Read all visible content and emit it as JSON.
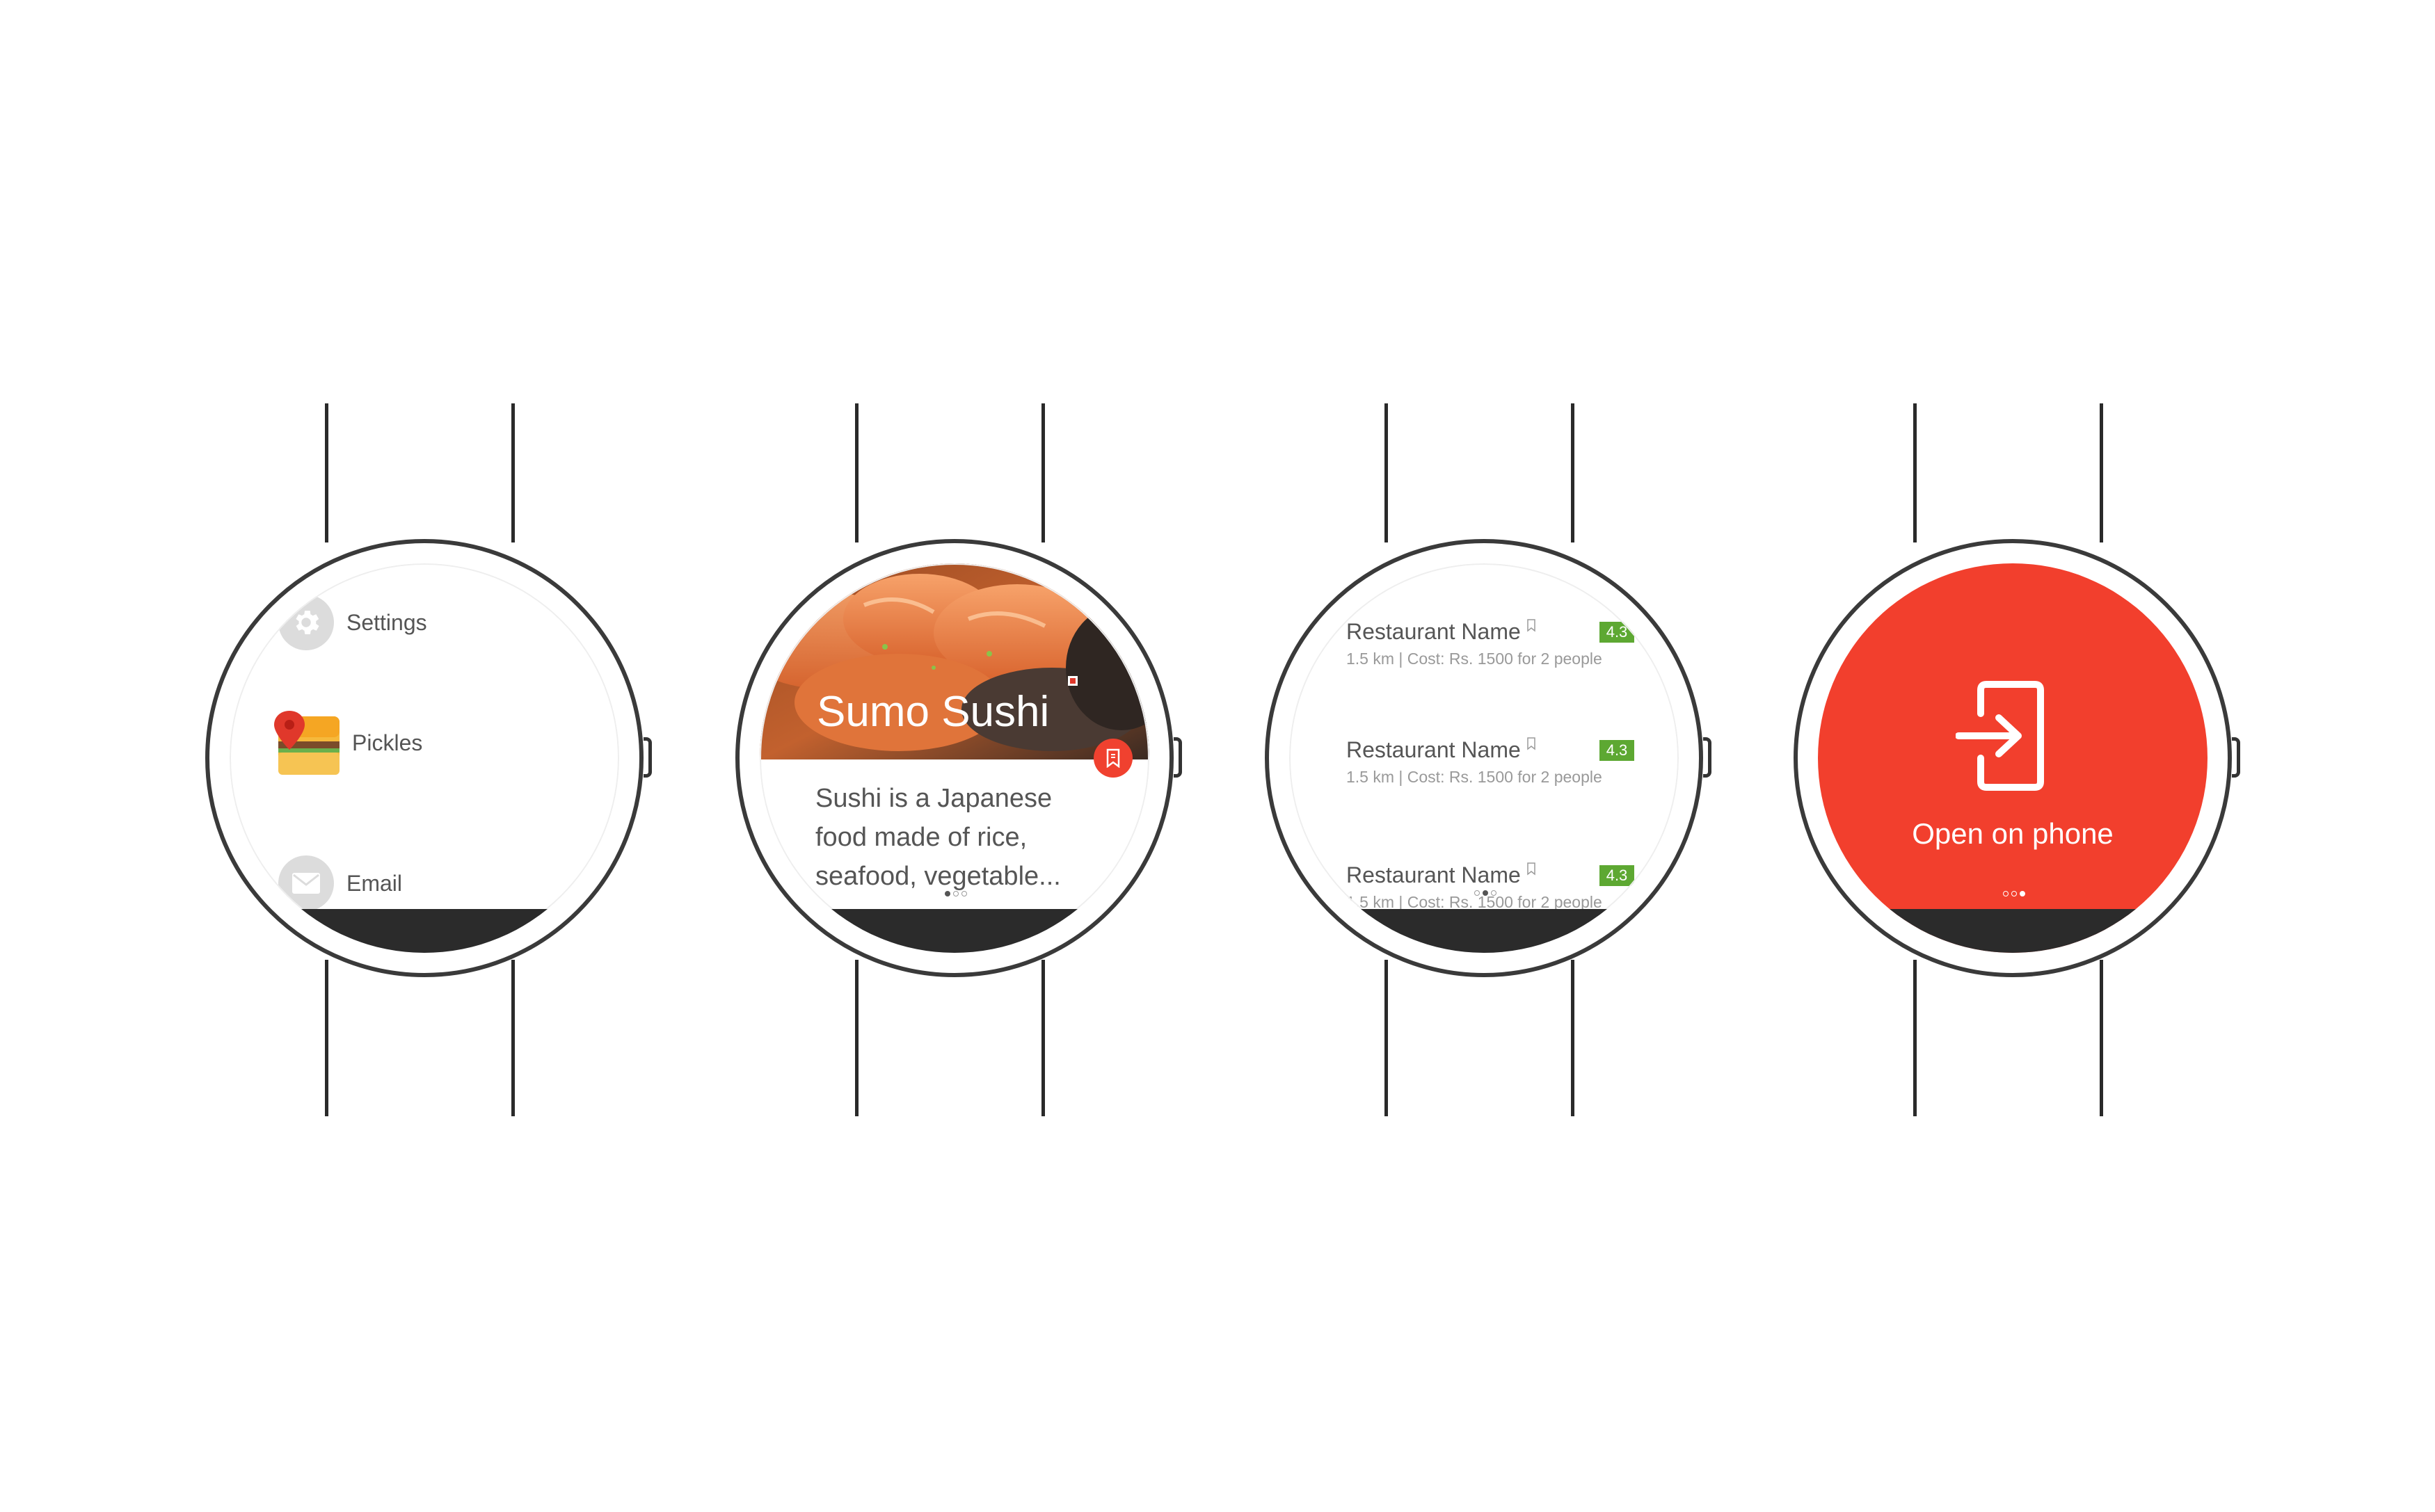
{
  "menu_screen": {
    "items": [
      {
        "label": "Settings",
        "icon": "gear-icon"
      },
      {
        "label": "Pickles",
        "icon": "pickles-app-icon"
      },
      {
        "label": "Email",
        "icon": "envelope-icon"
      }
    ]
  },
  "card_screen": {
    "title": "Sumo Sushi",
    "description": "Sushi is a Japanese food made of rice, seafood, vegetable...",
    "page_dots": {
      "count": 3,
      "active": 0
    }
  },
  "list_screen": {
    "restaurants": [
      {
        "name": "Restaurant Name",
        "rating": "4.3",
        "meta": "1.5 km | Cost: Rs. 1500 for 2 people"
      },
      {
        "name": "Restaurant Name",
        "rating": "4.3",
        "meta": "1.5 km | Cost: Rs. 1500 for 2 people"
      },
      {
        "name": "Restaurant Name",
        "rating": "4.3",
        "meta": "1.5 km | Cost: Rs. 1500 for 2 people"
      }
    ],
    "page_dots": {
      "count": 3,
      "active": 1
    }
  },
  "phone_screen": {
    "label": "Open on phone",
    "icon": "open-on-phone-icon",
    "page_dots": {
      "count": 3,
      "active": 2
    }
  },
  "colors": {
    "accent_red": "#f23f2d",
    "rating_green": "#5da832",
    "watch_outline": "#3a3a3a",
    "chin": "#2b2b2b"
  }
}
